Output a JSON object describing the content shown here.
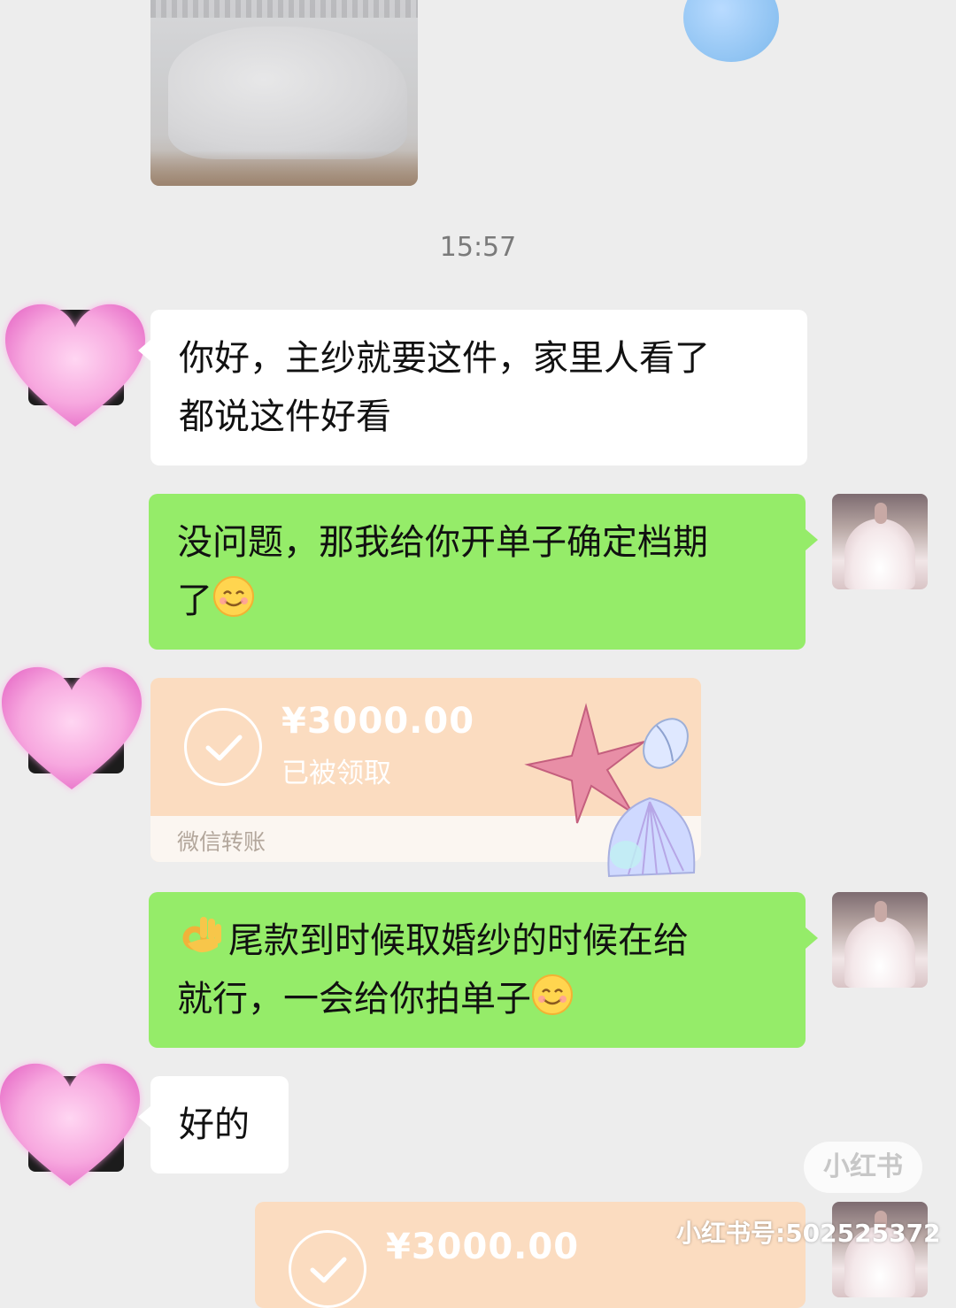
{
  "chat": {
    "timestamp": "15:57",
    "messages": [
      {
        "side": "left",
        "type": "text",
        "text_lines": [
          "你好，主纱就要这件，家里人看了",
          "都说这件好看"
        ]
      },
      {
        "side": "right",
        "type": "text",
        "line1": "没问题，那我给你开单子确定档期",
        "line2": "了",
        "emoji": "smile"
      },
      {
        "side": "left",
        "type": "transfer",
        "amount": "¥3000.00",
        "status": "已被领取",
        "label": "微信转账"
      },
      {
        "side": "right",
        "type": "text",
        "lead_emoji": "ok-hand",
        "line1": "尾款到时候取婚纱的时候在给",
        "line2": "就行，一会给你拍单子",
        "emoji": "smile"
      },
      {
        "side": "left",
        "type": "text",
        "text": "好的"
      },
      {
        "side": "right",
        "type": "transfer",
        "amount": "¥3000.00"
      }
    ]
  },
  "watermark": {
    "logo": "小红书",
    "id": "小红书号:502525372"
  },
  "colors": {
    "background": "#ededed",
    "sent_bubble": "#95ec69",
    "received_bubble": "#ffffff",
    "transfer_card": "#fbdcc0"
  }
}
